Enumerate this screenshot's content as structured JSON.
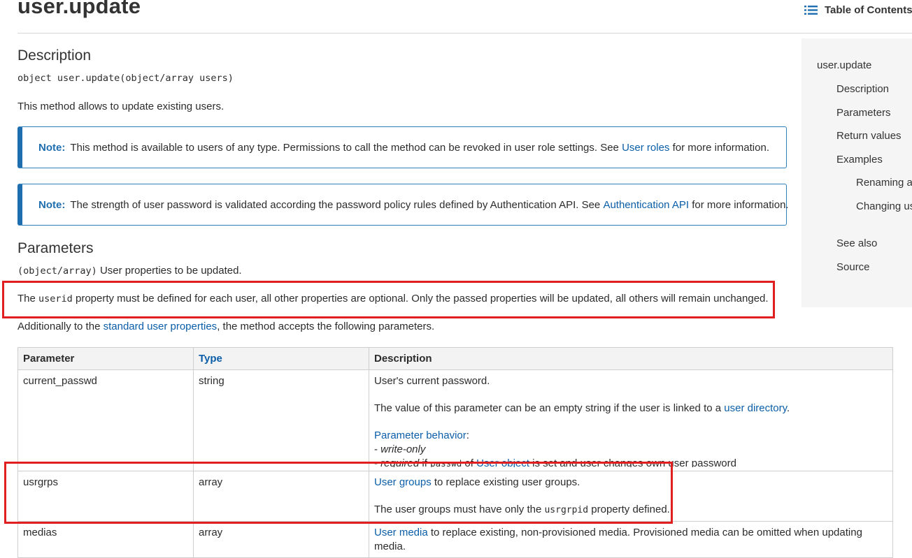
{
  "page": {
    "title": "user.update",
    "toc_label": "Table of Contents"
  },
  "toc": {
    "items": [
      "user.update",
      "Description",
      "Parameters",
      "Return values",
      "Examples",
      "Renaming a",
      "Changing us",
      "See also",
      "Source"
    ]
  },
  "description": {
    "heading": "Description",
    "signature": "object user.update(object/array users)",
    "summary": "This method allows to update existing users.",
    "note1": {
      "label": "Note:",
      "text": "This method is available to users of any type. Permissions to call the method can be revoked in user role settings. See",
      "link": "User roles",
      "tail": "for more information."
    },
    "note2": {
      "label": "Note:",
      "text": "The strength of user password is validated according the password policy rules defined by Authentication API. See",
      "link": "Authentication API",
      "tail": "for more information."
    }
  },
  "parameters": {
    "heading": "Parameters",
    "type_code": "(object/array)",
    "intro": "User properties to be updated.",
    "userid_pre": "The",
    "userid_code": "userid",
    "userid_post": "property must be defined for each user, all other properties are optional. Only the passed properties will be updated, all others will remain unchanged.",
    "additional_pre": "Additionally to the",
    "additional_link": "standard user properties",
    "additional_post": ", the method accepts the following parameters.",
    "table": {
      "headers": {
        "parameter": "Parameter",
        "type": "Type",
        "description": "Description"
      },
      "rows": [
        {
          "param": "current_passwd",
          "type": "string",
          "desc1": "User's current password.",
          "desc2_pre": "The value of this parameter can be an empty string if the user is linked to a",
          "desc2_link": "user directory",
          "desc2_post": ".",
          "behavior_link": "Parameter behavior",
          "behavior_colon": ":",
          "behavior_1_dash": "-",
          "behavior_1": "write-only",
          "behavior_2_dash": "-",
          "behavior_2_em": "required",
          "behavior_2_if": "if",
          "behavior_2_code": "passwd",
          "behavior_2_of": "of",
          "behavior_2_link": "User object",
          "behavior_2_tail": "is set and user changes own user password"
        },
        {
          "param": "usrgrps",
          "type": "array",
          "desc1_link": "User groups",
          "desc1_post": "to replace existing user groups.",
          "desc2_pre": "The user groups must have only the",
          "desc2_code": "usrgrpid",
          "desc2_post": "property defined."
        },
        {
          "param": "medias",
          "type": "array",
          "desc1_link": "User media",
          "desc1_post": "to replace existing, non-provisioned media. Provisioned media can be omitted when updating media."
        }
      ]
    }
  },
  "colors": {
    "link": "#0b5ea8",
    "note_border": "#1f6fb0",
    "annotation": "#e02020",
    "toc_bg": "#f5f5f5"
  },
  "icons": {
    "toc": "list-icon"
  }
}
